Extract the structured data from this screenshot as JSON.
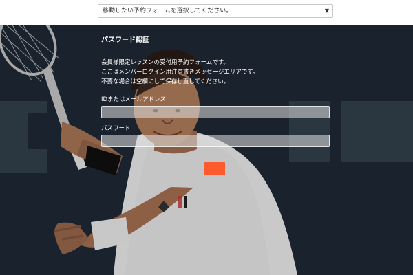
{
  "topbar": {
    "select_value": "移動したい予約フォームを選択してください。",
    "arrow_icon": "dropdown-arrow"
  },
  "form": {
    "title": "パスワード認証",
    "description": [
      "会員様限定レッスンの受付用予約フォームです。",
      "ここはメンバーログイン用注意書きメッセージエリアです。",
      "不要な場合は空欄にして保存し直してください。"
    ],
    "email_label": "IDまたはメールアドレス",
    "email_value": "",
    "password_label": "パスワード",
    "password_value": ""
  },
  "colors": {
    "background_dark": "#1f2a38",
    "input_border": "#ffffff",
    "tag_accent": "#ff5a2e"
  }
}
